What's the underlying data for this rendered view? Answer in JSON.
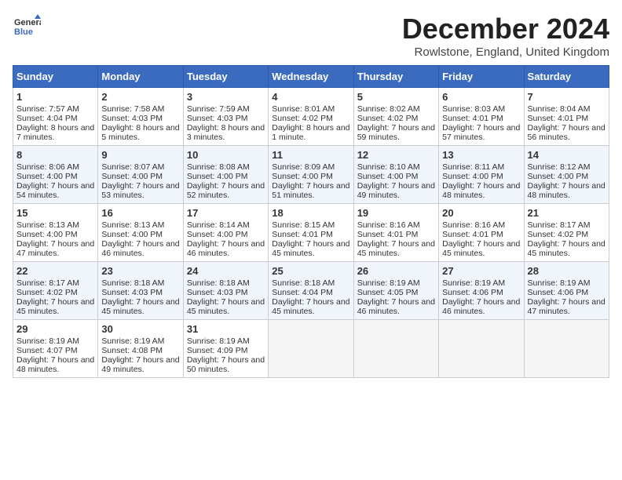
{
  "header": {
    "logo_line1": "General",
    "logo_line2": "Blue",
    "month": "December 2024",
    "location": "Rowlstone, England, United Kingdom"
  },
  "days_of_week": [
    "Sunday",
    "Monday",
    "Tuesday",
    "Wednesday",
    "Thursday",
    "Friday",
    "Saturday"
  ],
  "weeks": [
    [
      {
        "day": "1",
        "sunrise": "Sunrise: 7:57 AM",
        "sunset": "Sunset: 4:04 PM",
        "daylight": "Daylight: 8 hours and 7 minutes."
      },
      {
        "day": "2",
        "sunrise": "Sunrise: 7:58 AM",
        "sunset": "Sunset: 4:03 PM",
        "daylight": "Daylight: 8 hours and 5 minutes."
      },
      {
        "day": "3",
        "sunrise": "Sunrise: 7:59 AM",
        "sunset": "Sunset: 4:03 PM",
        "daylight": "Daylight: 8 hours and 3 minutes."
      },
      {
        "day": "4",
        "sunrise": "Sunrise: 8:01 AM",
        "sunset": "Sunset: 4:02 PM",
        "daylight": "Daylight: 8 hours and 1 minute."
      },
      {
        "day": "5",
        "sunrise": "Sunrise: 8:02 AM",
        "sunset": "Sunset: 4:02 PM",
        "daylight": "Daylight: 7 hours and 59 minutes."
      },
      {
        "day": "6",
        "sunrise": "Sunrise: 8:03 AM",
        "sunset": "Sunset: 4:01 PM",
        "daylight": "Daylight: 7 hours and 57 minutes."
      },
      {
        "day": "7",
        "sunrise": "Sunrise: 8:04 AM",
        "sunset": "Sunset: 4:01 PM",
        "daylight": "Daylight: 7 hours and 56 minutes."
      }
    ],
    [
      {
        "day": "8",
        "sunrise": "Sunrise: 8:06 AM",
        "sunset": "Sunset: 4:00 PM",
        "daylight": "Daylight: 7 hours and 54 minutes."
      },
      {
        "day": "9",
        "sunrise": "Sunrise: 8:07 AM",
        "sunset": "Sunset: 4:00 PM",
        "daylight": "Daylight: 7 hours and 53 minutes."
      },
      {
        "day": "10",
        "sunrise": "Sunrise: 8:08 AM",
        "sunset": "Sunset: 4:00 PM",
        "daylight": "Daylight: 7 hours and 52 minutes."
      },
      {
        "day": "11",
        "sunrise": "Sunrise: 8:09 AM",
        "sunset": "Sunset: 4:00 PM",
        "daylight": "Daylight: 7 hours and 51 minutes."
      },
      {
        "day": "12",
        "sunrise": "Sunrise: 8:10 AM",
        "sunset": "Sunset: 4:00 PM",
        "daylight": "Daylight: 7 hours and 49 minutes."
      },
      {
        "day": "13",
        "sunrise": "Sunrise: 8:11 AM",
        "sunset": "Sunset: 4:00 PM",
        "daylight": "Daylight: 7 hours and 48 minutes."
      },
      {
        "day": "14",
        "sunrise": "Sunrise: 8:12 AM",
        "sunset": "Sunset: 4:00 PM",
        "daylight": "Daylight: 7 hours and 48 minutes."
      }
    ],
    [
      {
        "day": "15",
        "sunrise": "Sunrise: 8:13 AM",
        "sunset": "Sunset: 4:00 PM",
        "daylight": "Daylight: 7 hours and 47 minutes."
      },
      {
        "day": "16",
        "sunrise": "Sunrise: 8:13 AM",
        "sunset": "Sunset: 4:00 PM",
        "daylight": "Daylight: 7 hours and 46 minutes."
      },
      {
        "day": "17",
        "sunrise": "Sunrise: 8:14 AM",
        "sunset": "Sunset: 4:00 PM",
        "daylight": "Daylight: 7 hours and 46 minutes."
      },
      {
        "day": "18",
        "sunrise": "Sunrise: 8:15 AM",
        "sunset": "Sunset: 4:01 PM",
        "daylight": "Daylight: 7 hours and 45 minutes."
      },
      {
        "day": "19",
        "sunrise": "Sunrise: 8:16 AM",
        "sunset": "Sunset: 4:01 PM",
        "daylight": "Daylight: 7 hours and 45 minutes."
      },
      {
        "day": "20",
        "sunrise": "Sunrise: 8:16 AM",
        "sunset": "Sunset: 4:01 PM",
        "daylight": "Daylight: 7 hours and 45 minutes."
      },
      {
        "day": "21",
        "sunrise": "Sunrise: 8:17 AM",
        "sunset": "Sunset: 4:02 PM",
        "daylight": "Daylight: 7 hours and 45 minutes."
      }
    ],
    [
      {
        "day": "22",
        "sunrise": "Sunrise: 8:17 AM",
        "sunset": "Sunset: 4:02 PM",
        "daylight": "Daylight: 7 hours and 45 minutes."
      },
      {
        "day": "23",
        "sunrise": "Sunrise: 8:18 AM",
        "sunset": "Sunset: 4:03 PM",
        "daylight": "Daylight: 7 hours and 45 minutes."
      },
      {
        "day": "24",
        "sunrise": "Sunrise: 8:18 AM",
        "sunset": "Sunset: 4:03 PM",
        "daylight": "Daylight: 7 hours and 45 minutes."
      },
      {
        "day": "25",
        "sunrise": "Sunrise: 8:18 AM",
        "sunset": "Sunset: 4:04 PM",
        "daylight": "Daylight: 7 hours and 45 minutes."
      },
      {
        "day": "26",
        "sunrise": "Sunrise: 8:19 AM",
        "sunset": "Sunset: 4:05 PM",
        "daylight": "Daylight: 7 hours and 46 minutes."
      },
      {
        "day": "27",
        "sunrise": "Sunrise: 8:19 AM",
        "sunset": "Sunset: 4:06 PM",
        "daylight": "Daylight: 7 hours and 46 minutes."
      },
      {
        "day": "28",
        "sunrise": "Sunrise: 8:19 AM",
        "sunset": "Sunset: 4:06 PM",
        "daylight": "Daylight: 7 hours and 47 minutes."
      }
    ],
    [
      {
        "day": "29",
        "sunrise": "Sunrise: 8:19 AM",
        "sunset": "Sunset: 4:07 PM",
        "daylight": "Daylight: 7 hours and 48 minutes."
      },
      {
        "day": "30",
        "sunrise": "Sunrise: 8:19 AM",
        "sunset": "Sunset: 4:08 PM",
        "daylight": "Daylight: 7 hours and 49 minutes."
      },
      {
        "day": "31",
        "sunrise": "Sunrise: 8:19 AM",
        "sunset": "Sunset: 4:09 PM",
        "daylight": "Daylight: 7 hours and 50 minutes."
      },
      null,
      null,
      null,
      null
    ]
  ]
}
